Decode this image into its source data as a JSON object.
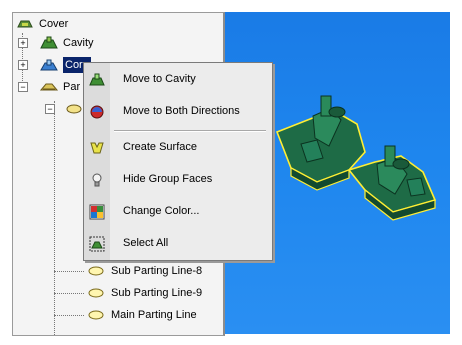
{
  "tree": {
    "root_label": "Cover",
    "cavity_label": "Cavity",
    "core_label": "Core",
    "parting_label": "Par",
    "parting_lines": [
      {
        "label": "Sub Parting Line-8"
      },
      {
        "label": "Sub Parting Line-9"
      },
      {
        "label": "Main Parting Line"
      }
    ]
  },
  "menu": {
    "items": [
      {
        "label": "Move to Cavity",
        "icon": "move-to-cavity-icon"
      },
      {
        "label": "Move to Both Directions",
        "icon": "move-both-directions-icon"
      },
      {
        "label": "Create Surface",
        "icon": "create-surface-icon"
      },
      {
        "label": "Hide Group Faces",
        "icon": "lightbulb-icon"
      },
      {
        "label": "Change Color...",
        "icon": "palette-icon"
      },
      {
        "label": "Select All",
        "icon": "select-all-icon"
      }
    ]
  },
  "colors": {
    "viewport_blue": "#1e86ee",
    "model_green": "#1e6b46",
    "model_edge": "#ffee33",
    "selection": "#0a246a"
  }
}
